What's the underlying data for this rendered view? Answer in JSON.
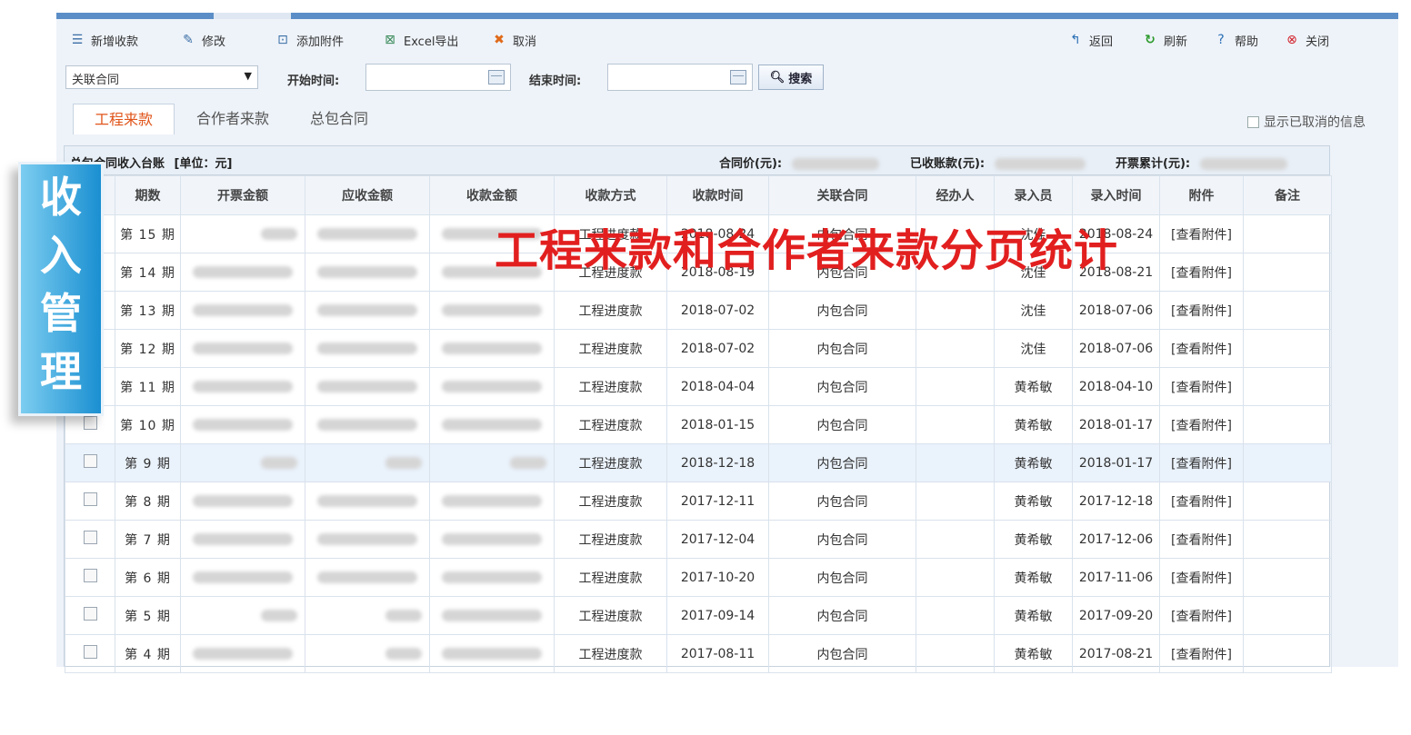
{
  "toolbar": {
    "new_label": "新增收款",
    "edit_label": "修改",
    "attach_label": "添加附件",
    "excel_label": "Excel导出",
    "cancel_label": "取消",
    "back_label": "返回",
    "refresh_label": "刷新",
    "help_label": "帮助",
    "close_label": "关闭"
  },
  "filter": {
    "contract_select": "关联合同",
    "start_label": "开始时间:",
    "start_value": "",
    "end_label": "结束时间:",
    "end_value": "",
    "search_label": "搜索"
  },
  "tabs": [
    {
      "label": "工程来款",
      "active": true
    },
    {
      "label": "合作者来款",
      "active": false
    },
    {
      "label": "总包合同",
      "active": false
    }
  ],
  "show_cancelled_label": "显示已取消的信息",
  "ledger": {
    "title": "总包合同收入台账",
    "unit": "[单位：元]",
    "contract_price_label": "合同价(元):",
    "received_label": "已收账款(元):",
    "invoiced_label": "开票累计(元):"
  },
  "table": {
    "headers": [
      "期数",
      "开票金额",
      "应收金额",
      "收款金额",
      "收款方式",
      "收款时间",
      "关联合同",
      "经办人",
      "录入员",
      "录入时间",
      "附件",
      "备注"
    ],
    "rows": [
      {
        "period": "第 15 期",
        "method": "工程进度款",
        "pay_date": "2018-08-24",
        "contract": "内包合同",
        "handler": "",
        "entry_by": "沈佳",
        "entry_date": "2018-08-24",
        "attachment": "[查看附件]",
        "remark": ""
      },
      {
        "period": "第 14 期",
        "method": "工程进度款",
        "pay_date": "2018-08-19",
        "contract": "内包合同",
        "handler": "",
        "entry_by": "沈佳",
        "entry_date": "2018-08-21",
        "attachment": "[查看附件]",
        "remark": ""
      },
      {
        "period": "第 13 期",
        "method": "工程进度款",
        "pay_date": "2018-07-02",
        "contract": "内包合同",
        "handler": "",
        "entry_by": "沈佳",
        "entry_date": "2018-07-06",
        "attachment": "[查看附件]",
        "remark": ""
      },
      {
        "period": "第 12 期",
        "method": "工程进度款",
        "pay_date": "2018-07-02",
        "contract": "内包合同",
        "handler": "",
        "entry_by": "沈佳",
        "entry_date": "2018-07-06",
        "attachment": "[查看附件]",
        "remark": ""
      },
      {
        "period": "第 11 期",
        "method": "工程进度款",
        "pay_date": "2018-04-04",
        "contract": "内包合同",
        "handler": "",
        "entry_by": "黄希敏",
        "entry_date": "2018-04-10",
        "attachment": "[查看附件]",
        "remark": ""
      },
      {
        "period": "第 10 期",
        "method": "工程进度款",
        "pay_date": "2018-01-15",
        "contract": "内包合同",
        "handler": "",
        "entry_by": "黄希敏",
        "entry_date": "2018-01-17",
        "attachment": "[查看附件]",
        "remark": ""
      },
      {
        "period": "第 9 期",
        "method": "工程进度款",
        "pay_date": "2018-12-18",
        "contract": "内包合同",
        "handler": "",
        "entry_by": "黄希敏",
        "entry_date": "2018-01-17",
        "attachment": "[查看附件]",
        "remark": ""
      },
      {
        "period": "第 8 期",
        "method": "工程进度款",
        "pay_date": "2017-12-11",
        "contract": "内包合同",
        "handler": "",
        "entry_by": "黄希敏",
        "entry_date": "2017-12-18",
        "attachment": "[查看附件]",
        "remark": ""
      },
      {
        "period": "第 7 期",
        "method": "工程进度款",
        "pay_date": "2017-12-04",
        "contract": "内包合同",
        "handler": "",
        "entry_by": "黄希敏",
        "entry_date": "2017-12-06",
        "attachment": "[查看附件]",
        "remark": ""
      },
      {
        "period": "第 6 期",
        "method": "工程进度款",
        "pay_date": "2017-10-20",
        "contract": "内包合同",
        "handler": "",
        "entry_by": "黄希敏",
        "entry_date": "2017-11-06",
        "attachment": "[查看附件]",
        "remark": ""
      },
      {
        "period": "第 5 期",
        "method": "工程进度款",
        "pay_date": "2017-09-14",
        "contract": "内包合同",
        "handler": "",
        "entry_by": "黄希敏",
        "entry_date": "2017-09-20",
        "attachment": "[查看附件]",
        "remark": ""
      },
      {
        "period": "第 4 期",
        "method": "工程进度款",
        "pay_date": "2017-08-11",
        "contract": "内包合同",
        "handler": "",
        "entry_by": "黄希敏",
        "entry_date": "2017-08-21",
        "attachment": "[查看附件]",
        "remark": ""
      }
    ]
  },
  "side_badge": "收入管理",
  "overlay_caption": "工程来款和合作者来款分页统计",
  "colors": {
    "accent_blue": "#5b8ec7",
    "tab_active": "#e0541a",
    "overlay_red": "#e21f1f",
    "badge_blue": "#1a8fd1"
  },
  "icons": [
    "stack-icon",
    "edit-icon",
    "attach-icon",
    "excel-icon",
    "cancel-icon",
    "back-icon",
    "refresh-icon",
    "help-icon",
    "close-icon",
    "calendar-icon",
    "search-icon"
  ]
}
